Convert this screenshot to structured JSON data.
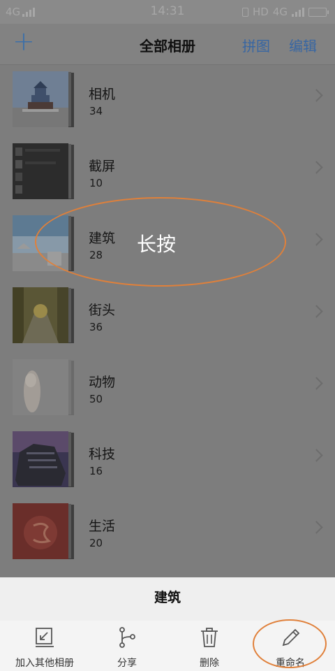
{
  "status": {
    "network_left": "4G",
    "time": "14:31",
    "hd": "HD",
    "network_right": "4G"
  },
  "header": {
    "add_icon": "plus-icon",
    "title": "全部相册",
    "collage_label": "拼图",
    "edit_label": "编辑"
  },
  "albums": [
    {
      "name": "相机",
      "count": "34"
    },
    {
      "name": "截屏",
      "count": "10"
    },
    {
      "name": "建筑",
      "count": "28"
    },
    {
      "name": "街头",
      "count": "36"
    },
    {
      "name": "动物",
      "count": "50"
    },
    {
      "name": "科技",
      "count": "16"
    },
    {
      "name": "生活",
      "count": "20"
    }
  ],
  "annotation": {
    "label": "长按",
    "color": "#e0803a"
  },
  "sheet": {
    "title": "建筑",
    "actions": [
      {
        "label": "加入其他相册",
        "icon": "add-to-album-icon"
      },
      {
        "label": "分享",
        "icon": "share-icon"
      },
      {
        "label": "删除",
        "icon": "trash-icon"
      },
      {
        "label": "重命名",
        "icon": "pencil-icon"
      }
    ]
  },
  "colors": {
    "accent": "#3766a3",
    "overlay": "#7d7d7d",
    "highlight": "#e0803a"
  }
}
